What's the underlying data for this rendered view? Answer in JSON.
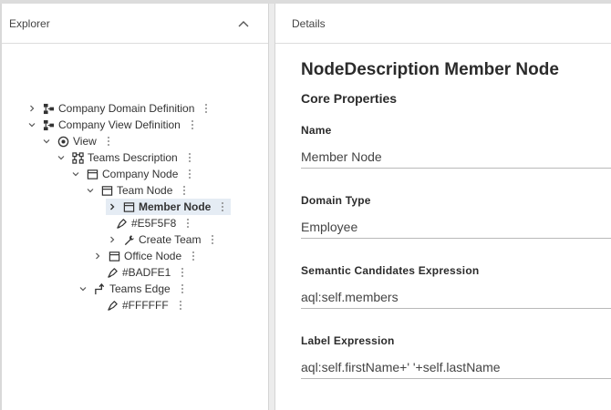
{
  "explorer": {
    "title": "Explorer",
    "tree": [
      {
        "id": "company-domain-definition",
        "label": "Company Domain Definition",
        "icon": "domain-icon",
        "chevron": "right"
      },
      {
        "id": "company-view-definition",
        "label": "Company View Definition",
        "icon": "domain-icon",
        "chevron": "down"
      },
      {
        "id": "view",
        "label": "View",
        "icon": "eye-icon",
        "chevron": "down"
      },
      {
        "id": "teams-description",
        "label": "Teams Description",
        "icon": "diagram-icon",
        "chevron": "down"
      },
      {
        "id": "company-node",
        "label": "Company Node",
        "icon": "node-icon",
        "chevron": "down"
      },
      {
        "id": "team-node",
        "label": "Team Node",
        "icon": "node-icon",
        "chevron": "down"
      },
      {
        "id": "member-node",
        "label": "Member Node",
        "icon": "node-icon",
        "chevron": "right",
        "selected": true
      },
      {
        "id": "style-e5f5f8",
        "label": "#E5F5F8",
        "icon": "paint-icon",
        "chevron": "none"
      },
      {
        "id": "create-team",
        "label": "Create Team",
        "icon": "wrench-icon",
        "chevron": "right"
      },
      {
        "id": "office-node",
        "label": "Office Node",
        "icon": "node-icon",
        "chevron": "right"
      },
      {
        "id": "style-badfe1",
        "label": "#BADFE1",
        "icon": "paint-icon",
        "chevron": "none"
      },
      {
        "id": "teams-edge",
        "label": "Teams Edge",
        "icon": "edge-icon",
        "chevron": "down"
      },
      {
        "id": "style-ffffff",
        "label": "#FFFFFF",
        "icon": "paint-icon",
        "chevron": "none"
      }
    ]
  },
  "details": {
    "title": "Details",
    "node_title": "NodeDescription Member Node",
    "section": "Core Properties",
    "fields": [
      {
        "label": "Name",
        "value": "Member Node"
      },
      {
        "label": "Domain Type",
        "value": "Employee"
      },
      {
        "label": "Semantic Candidates Expression",
        "value": "aql:self.members"
      },
      {
        "label": "Label Expression",
        "value": "aql:self.firstName+' '+self.lastName"
      }
    ]
  },
  "colors": {
    "selected_row": "#e5ecf4",
    "border": "#dddddd",
    "text": "#333333"
  }
}
